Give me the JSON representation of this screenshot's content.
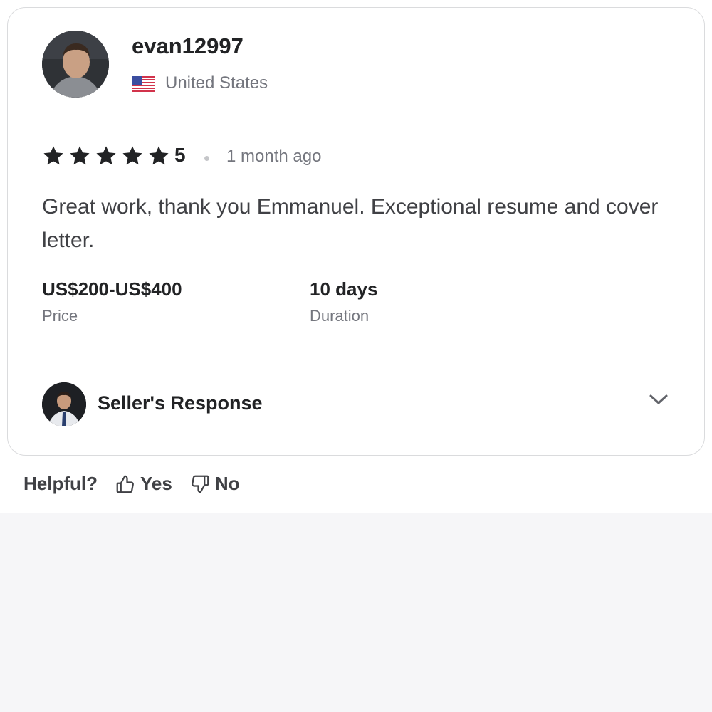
{
  "reviewer": {
    "username": "evan12997",
    "country": "United States",
    "flag_icon": "us-flag-icon"
  },
  "rating": {
    "stars": 5,
    "value": "5",
    "time_ago": "1 month ago",
    "star_color": "#222325"
  },
  "review": {
    "text": "Great work, thank you Emmanuel. Exceptional resume and cover letter."
  },
  "stats": [
    {
      "value": "US$200-US$400",
      "label": "Price"
    },
    {
      "value": "10 days",
      "label": "Duration"
    }
  ],
  "seller_response": {
    "title": "Seller's Response",
    "icon": "chevron-down-icon"
  },
  "helpful": {
    "label": "Helpful?",
    "yes_label": "Yes",
    "no_label": "No"
  },
  "colors": {
    "text_primary": "#222325",
    "text_secondary": "#74767e",
    "border": "#dadbdd",
    "page_background": "#f6f6f8"
  }
}
